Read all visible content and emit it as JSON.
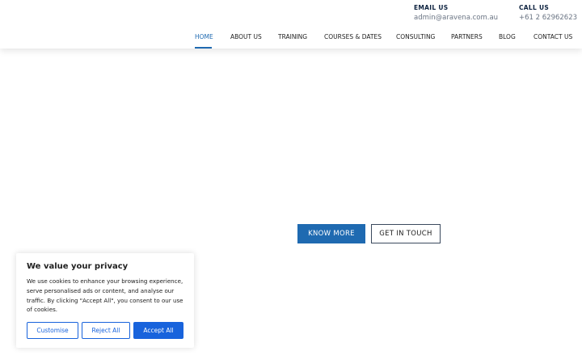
{
  "header": {
    "email": {
      "label": "EMAIL US",
      "value": "admin@aravena.com.au"
    },
    "call": {
      "label": "CALL US",
      "value": "+61 2 62962623"
    }
  },
  "nav": {
    "items": [
      {
        "label": "HOME",
        "active": true
      },
      {
        "label": "ABOUT US"
      },
      {
        "label": "TRAINING"
      },
      {
        "label": "COURSES & DATES"
      },
      {
        "label": "CONSULTING"
      },
      {
        "label": "PARTNERS"
      },
      {
        "label": "BLOG"
      },
      {
        "label": "CONTACT US"
      }
    ]
  },
  "hero": {
    "know_more_label": "KNOW MORE",
    "get_in_touch_label": "GET IN TOUCH"
  },
  "cookie_banner": {
    "title": "We value your privacy",
    "text": "We use cookies to enhance your browsing experience, serve personalised ads or content, and analyse our traffic. By clicking \"Accept All\", you consent to our use of cookies.",
    "customise_label": "Customise",
    "reject_label": "Reject All",
    "accept_label": "Accept All"
  },
  "colors": {
    "accent": "#1f6ab1",
    "cookie_accent": "#1863dc",
    "heading": "#0e2340"
  }
}
